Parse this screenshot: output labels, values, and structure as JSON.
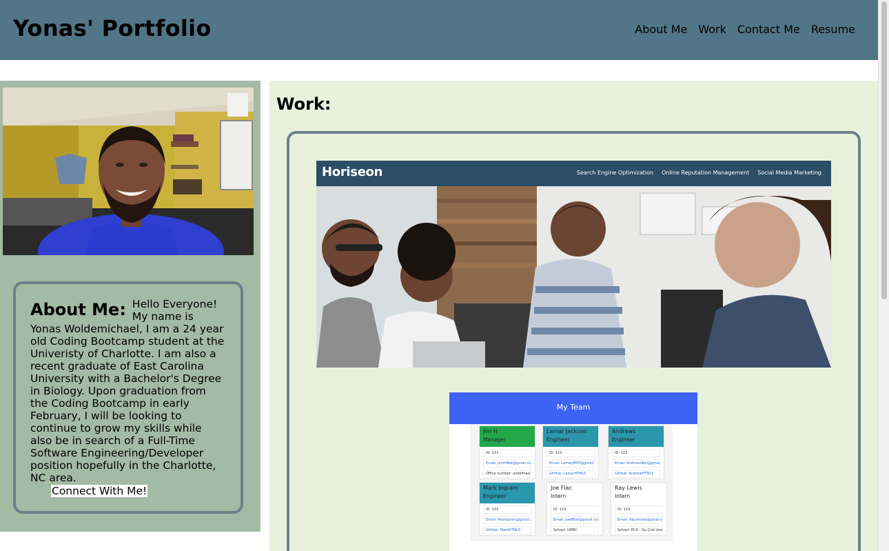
{
  "header": {
    "title": "Yonas' Portfolio",
    "nav": [
      "About Me",
      "Work",
      "Contact Me",
      "Resume"
    ]
  },
  "about": {
    "heading": "About Me:",
    "text": "Hello Everyone! My name is Yonas Woldemichael, I am a 24 year old Coding Bootcamp student at the Univeristy of Charlotte. I am also a recent graduate of East Carolina University with a Bachelor's Degree in Biology. Upon graduation from the Coding Bootcamp in early February, I will be looking to continue to grow my skills while also be in search of a Full-Time Software Engineering/Developer position hopefully in the Charlotte, NC area.",
    "connect_label": "Connect With Me!"
  },
  "work": {
    "heading": "Work:",
    "project1": {
      "logo": "Horiseon",
      "nav": [
        "Search Engine Optimization",
        "Online Reputation Management",
        "Social Media Marketing"
      ]
    },
    "project2": {
      "title": "My Team",
      "cards": [
        {
          "name": "Jim H",
          "role": "Manager",
          "lines": [
            "ID: 123",
            "Email: JimHtBat@gmail.com",
            "Office number: undefined"
          ]
        },
        {
          "name": "Lamar Jackson",
          "role": "Engineer",
          "lines": [
            "ID: 123",
            "Email: LamarJMVP@gmail.com",
            "GitHub: LamarHTML5"
          ]
        },
        {
          "name": "Andrews",
          "role": "Engineer",
          "lines": [
            "ID: 123",
            "Email: AndrewsBall@gmail.com",
            "GitHub: AndrewHTML5"
          ]
        },
        {
          "name": "Mark Ingram",
          "role": "Engineer",
          "lines": [
            "ID: 123",
            "Email: MarkIgram@gmail.com",
            "GitHub: MarkHTML5"
          ]
        },
        {
          "name": "Joe Flac",
          "role": "Intern",
          "lines": [
            "ID: 123",
            "Email: JoeBBall@gmail.com",
            "School: UMBC"
          ]
        },
        {
          "name": "Ray Lewis",
          "role": "Intern",
          "lines": [
            "ID: 123",
            "Email: Rayrentwi@gmail.com",
            "School: ECU - Go Crib Uno"
          ]
        }
      ]
    }
  },
  "colors": {
    "header": "#517687",
    "left_panel": "#a3baa4",
    "work_panel": "#e7f1dc",
    "frame_border": "#6f7f8c",
    "manager_card": "#22a84a",
    "engineer_card": "#2b97ad",
    "team_header": "#3d63f5"
  }
}
